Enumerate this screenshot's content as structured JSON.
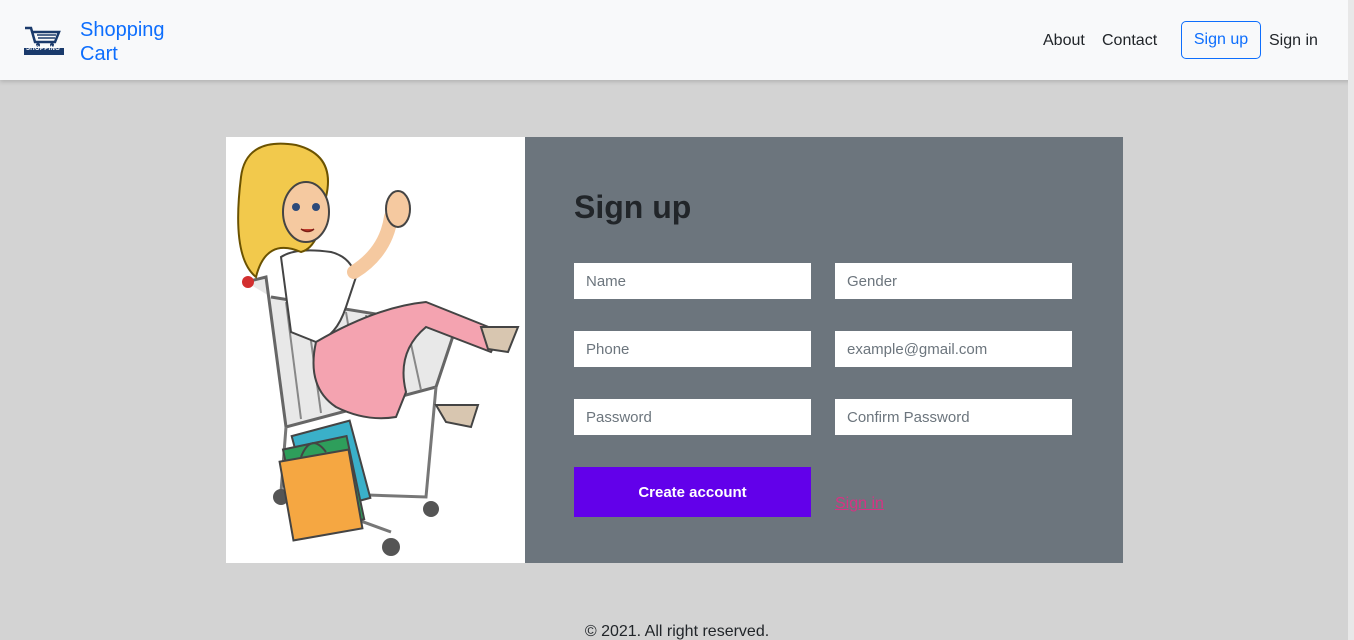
{
  "navbar": {
    "brand_line1": "Shopping",
    "brand_line2": "Cart",
    "logo_caption": "SHOPPING",
    "links": {
      "about": "About",
      "contact": "Contact",
      "signup": "Sign up",
      "signin": "Sign in"
    }
  },
  "form": {
    "title": "Sign up",
    "placeholders": {
      "name": "Name",
      "gender": "Gender",
      "phone": "Phone",
      "email": "example@gmail.com",
      "password": "Password",
      "confirm_password": "Confirm Password"
    },
    "create_label": "Create account",
    "signin_link": "Sign in"
  },
  "footer": {
    "text": "© 2021. All right reserved."
  },
  "colors": {
    "accent": "#0d6efd",
    "create_button": "#6200ea",
    "signin_link": "#d63384",
    "panel": "#6c757d",
    "page_bg": "#d3d3d3"
  }
}
